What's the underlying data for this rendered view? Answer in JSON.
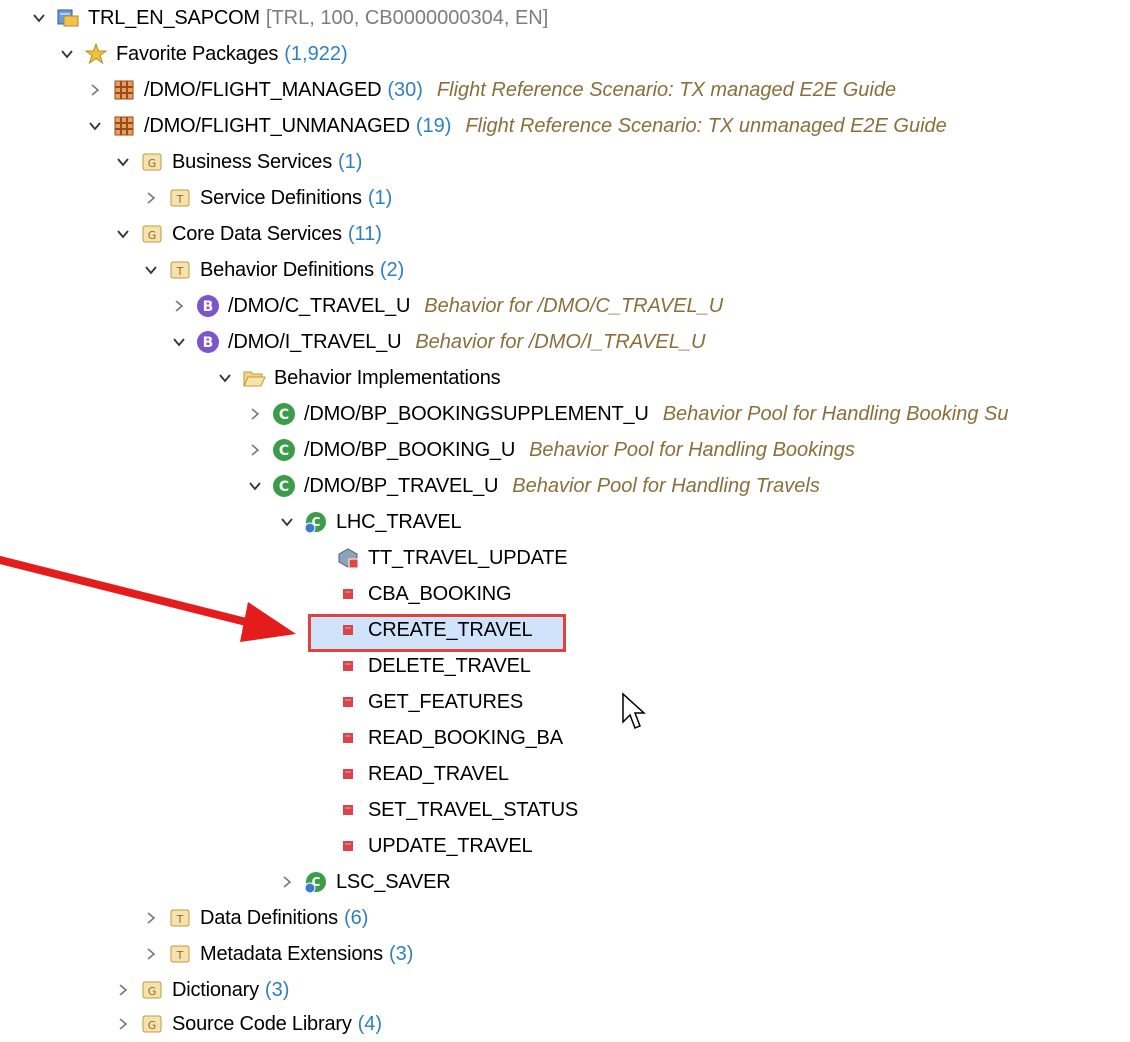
{
  "tree": {
    "root": {
      "label": "TRL_EN_SAPCOM",
      "connection": "[TRL, 100, CB0000000304, EN]"
    },
    "favorites": {
      "label": "Favorite Packages",
      "count": "(1,922)"
    },
    "pkg_managed": {
      "label": "/DMO/FLIGHT_MANAGED",
      "count": "(30)",
      "desc": "Flight Reference Scenario: TX managed E2E Guide"
    },
    "pkg_unmanaged": {
      "label": "/DMO/FLIGHT_UNMANAGED",
      "count": "(19)",
      "desc": "Flight Reference Scenario: TX unmanaged E2E Guide"
    },
    "business_services": {
      "label": "Business Services",
      "count": "(1)"
    },
    "service_definitions": {
      "label": "Service Definitions",
      "count": "(1)"
    },
    "core_data_services": {
      "label": "Core Data Services",
      "count": "(11)"
    },
    "behavior_definitions": {
      "label": "Behavior Definitions",
      "count": "(2)"
    },
    "c_travel_u": {
      "label": "/DMO/C_TRAVEL_U",
      "desc": "Behavior for /DMO/C_TRAVEL_U"
    },
    "i_travel_u": {
      "label": "/DMO/I_TRAVEL_U",
      "desc": "Behavior for /DMO/I_TRAVEL_U"
    },
    "behavior_implementations": {
      "label": "Behavior Implementations"
    },
    "bp_bookingsupplement": {
      "label": "/DMO/BP_BOOKINGSUPPLEMENT_U",
      "desc": "Behavior Pool for Handling Booking Su"
    },
    "bp_booking": {
      "label": "/DMO/BP_BOOKING_U",
      "desc": "Behavior Pool for Handling Bookings"
    },
    "bp_travel": {
      "label": "/DMO/BP_TRAVEL_U",
      "desc": "Behavior Pool for Handling Travels"
    },
    "lhc_travel": {
      "label": "LHC_TRAVEL"
    },
    "tt_travel_update": {
      "label": "TT_TRAVEL_UPDATE"
    },
    "methods": [
      "CBA_BOOKING",
      "CREATE_TRAVEL",
      "DELETE_TRAVEL",
      "GET_FEATURES",
      "READ_BOOKING_BA",
      "READ_TRAVEL",
      "SET_TRAVEL_STATUS",
      "UPDATE_TRAVEL"
    ],
    "lsc_saver": {
      "label": "LSC_SAVER"
    },
    "data_definitions": {
      "label": "Data Definitions",
      "count": "(6)"
    },
    "metadata_extensions": {
      "label": "Metadata Extensions",
      "count": "(3)"
    },
    "dictionary": {
      "label": "Dictionary",
      "count": "(3)"
    },
    "source_code_library": {
      "label": "Source Code Library",
      "count": "(4)"
    }
  },
  "icons": {
    "expanded": "chevron-down-icon",
    "collapsed": "chevron-right-icon",
    "package": "package-icon",
    "folder_g": "folder-group-icon",
    "folder_t": "folder-type-icon",
    "behavior": "behavior-definition-icon",
    "class": "class-icon",
    "local_class": "local-class-icon",
    "method": "method-icon",
    "type": "type-icon"
  },
  "colors": {
    "count": "#2f7fc1",
    "description": "#8a6f3a",
    "selection": "#cfe3fb",
    "highlight_red": "#e0423f",
    "method_red": "#d9434c"
  },
  "selected_item": "CREATE_TRAVEL"
}
